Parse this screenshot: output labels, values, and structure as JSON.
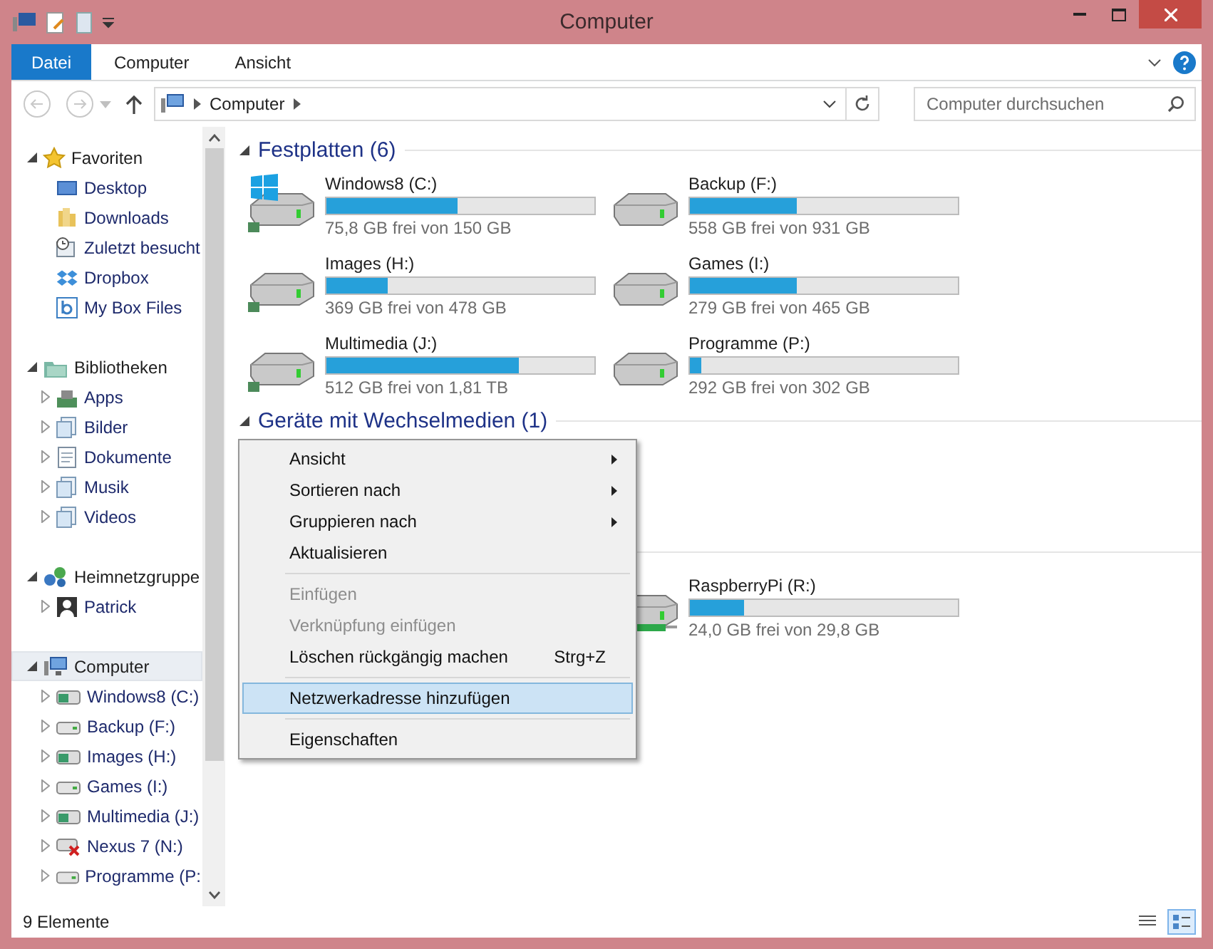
{
  "window": {
    "title": "Computer"
  },
  "ribbon_tabs": [
    {
      "label": "Datei",
      "selected": true
    },
    {
      "label": "Computer",
      "selected": false
    },
    {
      "label": "Ansicht",
      "selected": false
    }
  ],
  "address": {
    "path": [
      "Computer"
    ]
  },
  "search": {
    "placeholder": "Computer durchsuchen"
  },
  "sidebar": [
    {
      "label": "Favoriten",
      "kind": "star",
      "expanded": true,
      "selected": false,
      "children": [
        {
          "label": "Desktop",
          "kind": "desktop",
          "expandable": false,
          "selected": false
        },
        {
          "label": "Downloads",
          "kind": "folder",
          "expandable": false,
          "selected": false
        },
        {
          "label": "Zuletzt besucht",
          "kind": "recent",
          "expandable": false,
          "selected": false
        },
        {
          "label": "Dropbox",
          "kind": "dropbox",
          "expandable": false,
          "selected": false
        },
        {
          "label": "My Box Files",
          "kind": "box",
          "expandable": false,
          "selected": false
        }
      ]
    },
    {
      "label": "Bibliotheken",
      "kind": "library",
      "expanded": true,
      "selected": false,
      "children": [
        {
          "label": "Apps",
          "kind": "apps",
          "expandable": true,
          "selected": false
        },
        {
          "label": "Bilder",
          "kind": "libdoc",
          "expandable": true,
          "selected": false
        },
        {
          "label": "Dokumente",
          "kind": "page",
          "expandable": true,
          "selected": false
        },
        {
          "label": "Musik",
          "kind": "libdoc",
          "expandable": true,
          "selected": false
        },
        {
          "label": "Videos",
          "kind": "libdoc",
          "expandable": true,
          "selected": false
        }
      ]
    },
    {
      "label": "Heimnetzgruppe",
      "kind": "homegroup",
      "expanded": true,
      "selected": false,
      "children": [
        {
          "label": "Patrick",
          "kind": "user",
          "expandable": true,
          "selected": false
        }
      ]
    },
    {
      "label": "Computer",
      "kind": "computer",
      "expanded": true,
      "selected": true,
      "children": [
        {
          "label": "Windows8 (C:)",
          "kind": "shared",
          "expandable": true,
          "selected": false
        },
        {
          "label": "Backup (F:)",
          "kind": "drive",
          "expandable": true,
          "selected": false
        },
        {
          "label": "Images (H:)",
          "kind": "shared",
          "expandable": true,
          "selected": false
        },
        {
          "label": "Games (I:)",
          "kind": "drive",
          "expandable": true,
          "selected": false
        },
        {
          "label": "Multimedia (J:)",
          "kind": "shared",
          "expandable": true,
          "selected": false
        },
        {
          "label": "Nexus 7 (N:)",
          "kind": "device",
          "expandable": true,
          "selected": false
        },
        {
          "label": "Programme (P:",
          "kind": "drive",
          "expandable": true,
          "selected": false
        }
      ]
    }
  ],
  "sections": [
    {
      "title": "Festplatten (6)",
      "expanded": true,
      "drives": [
        {
          "name": "Windows8 (C:)",
          "free": "75,8 GB frei von 150 GB",
          "level": 0.49,
          "kind": "windows"
        },
        {
          "name": "Backup (F:)",
          "free": "558 GB frei von 931 GB",
          "level": 0.4,
          "kind": "hdd"
        },
        {
          "name": "Images (H:)",
          "free": "369 GB frei von 478 GB",
          "level": 0.23,
          "kind": "shared"
        },
        {
          "name": "Games (I:)",
          "free": "279 GB frei von 465 GB",
          "level": 0.4,
          "kind": "hdd"
        },
        {
          "name": "Multimedia (J:)",
          "free": "512 GB frei von 1,81 TB",
          "level": 0.72,
          "kind": "shared"
        },
        {
          "name": "Programme (P:)",
          "free": "292 GB frei von 302 GB",
          "level": 0.04,
          "kind": "hdd"
        }
      ]
    },
    {
      "title": "Geräte mit Wechselmedien (1)",
      "expanded": true
    },
    {
      "drives": [
        {
          "name": "RaspberryPi (R:)",
          "free": "24,0 GB frei von 29,8 GB",
          "level": 0.2,
          "kind": "network"
        }
      ]
    }
  ],
  "context_menu": [
    {
      "kind": "item",
      "label": "Ansicht",
      "submenu": true,
      "disabled": false,
      "selected": false
    },
    {
      "kind": "item",
      "label": "Sortieren nach",
      "submenu": true,
      "disabled": false,
      "selected": false
    },
    {
      "kind": "item",
      "label": "Gruppieren nach",
      "submenu": true,
      "disabled": false,
      "selected": false
    },
    {
      "kind": "item",
      "label": "Aktualisieren",
      "submenu": false,
      "disabled": false,
      "selected": false
    },
    {
      "kind": "separator"
    },
    {
      "kind": "item",
      "label": "Einfügen",
      "submenu": false,
      "disabled": true,
      "selected": false
    },
    {
      "kind": "item",
      "label": "Verknüpfung einfügen",
      "submenu": false,
      "disabled": true,
      "selected": false
    },
    {
      "kind": "item",
      "label": "Löschen rückgängig machen",
      "shortcut": "Strg+Z",
      "submenu": false,
      "disabled": false,
      "selected": false
    },
    {
      "kind": "separator"
    },
    {
      "kind": "item",
      "label": "Netzwerkadresse hinzufügen",
      "submenu": false,
      "disabled": false,
      "selected": true
    },
    {
      "kind": "separator"
    },
    {
      "kind": "item",
      "label": "Eigenschaften",
      "submenu": false,
      "disabled": false,
      "selected": false
    }
  ],
  "status_bar": {
    "text": "9 Elemente",
    "views": [
      {
        "kind": "details",
        "selected": false
      },
      {
        "kind": "tiles",
        "selected": true
      }
    ]
  }
}
